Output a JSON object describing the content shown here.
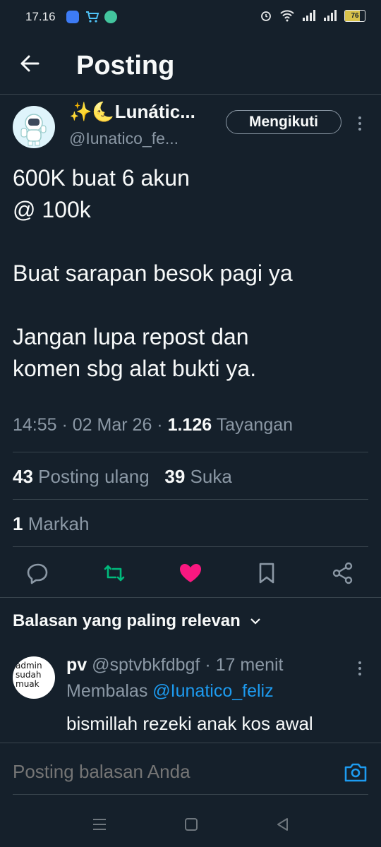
{
  "status_bar": {
    "time": "17.16",
    "battery": "76"
  },
  "header": {
    "title": "Posting"
  },
  "author": {
    "name": "✨🌜Lunátic...",
    "handle": "@Iunatico_fe...",
    "follow_label": "Mengikuti"
  },
  "post": {
    "text": "600K buat 6 akun\n@ 100k\n\nBuat sarapan besok pagi ya\n\nJangan lupa repost dan\nkomen sbg alat bukti ya.",
    "time": "14:55",
    "date": "02 Mar 26",
    "views_count": "1.126",
    "views_label": "Tayangan"
  },
  "stats": {
    "reposts_count": "43",
    "reposts_label": "Posting ulang",
    "likes_count": "39",
    "likes_label": "Suka",
    "bookmarks_count": "1",
    "bookmarks_label": "Markah"
  },
  "colors": {
    "repost": "#00ba7c",
    "like": "#f91880",
    "link": "#1d9bf0"
  },
  "replies_sort": "Balasan yang paling relevan",
  "reply": {
    "avatar_text": [
      "admin",
      "sudah",
      "muak"
    ],
    "name": "pv",
    "handle": "@sptvbkfdbgf",
    "time": "17 menit",
    "replying_label": "Membalas",
    "replying_to": "@Iunatico_feliz",
    "text": "bismillah rezeki anak kos awal"
  },
  "composer": {
    "placeholder": "Posting balasan Anda"
  }
}
